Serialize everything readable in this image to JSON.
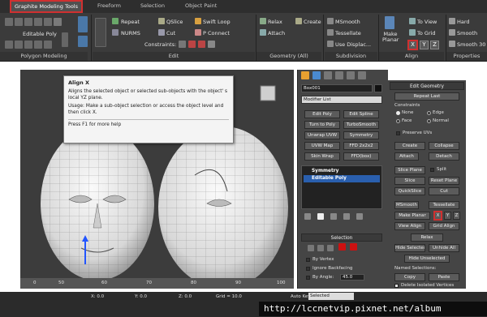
{
  "ribbon": {
    "tabs": [
      "Graphite Modeling Tools",
      "Freeform",
      "Selection",
      "Object Paint"
    ],
    "edit_poly_label": "Editable Poly",
    "polygon_modeling": "Polygon Modeling",
    "edit_items": {
      "repeat": "Repeat",
      "qslice": "QSlice",
      "swift_loop": "Swift Loop",
      "nurms": "NURMS",
      "cut": "Cut",
      "p_connect": "P Connect",
      "constraints": "Constraints:"
    },
    "geometry_items": {
      "relax": "Relax",
      "create": "Create",
      "attach": "Attach"
    },
    "subdivision_items": {
      "msmooth": "MSmooth",
      "tessellate": "Tessellate",
      "use_displac": "Use Displac..."
    },
    "align_items": {
      "make_planar": "Make Planar",
      "to_view": "To View",
      "to_grid": "To Grid",
      "x": "X",
      "y": "Y",
      "z": "Z"
    },
    "properties_items": {
      "hard": "Hard",
      "smooth": "Smooth",
      "smooth30": "Smooth 30"
    },
    "groups": {
      "edit": "Edit",
      "geometry": "Geometry (All)",
      "subdivision": "Subdivision",
      "align": "Align",
      "properties": "Properties"
    }
  },
  "tooltip": {
    "title": "Align X",
    "desc": "Aligns the selected object or selected sub-objects with the object' s local YZ plane.",
    "usage": "Usage: Make a sub-object selection or access the object level and then click X.",
    "help": "Press F1 for more help"
  },
  "command_panel": {
    "object_name": "Box001",
    "modifier_list": "Modifier List",
    "buttons": [
      "Edit Poly",
      "Edit Spline",
      "Turn to Poly",
      "TurboSmooth",
      "Unwrap UVW",
      "Symmetry",
      "UVW Map",
      "FFD 2x2x2",
      "Skin Wrap",
      "FFD(box)"
    ],
    "stack": [
      "Symmetry",
      "Editable Poly"
    ],
    "selection_header": "Selection",
    "selection_opts": [
      "By Vertex",
      "Ignore Backfacing",
      "By Angle:"
    ],
    "angle_value": "45.0"
  },
  "edit_geometry": {
    "header": "Edit Geometry",
    "repeat_last": "Repeat Last",
    "constraints": "Constraints",
    "radios": [
      "None",
      "Edge",
      "Face",
      "Normal"
    ],
    "preserve_uvs": "Preserve UVs",
    "create": "Create",
    "collapse": "Collapse",
    "attach": "Attach",
    "detach": "Detach",
    "slice_plane": "Slice Plane",
    "split": "Split",
    "slice": "Slice",
    "reset_plane": "Reset Plane",
    "quickslice": "QuickSlice",
    "cut": "Cut",
    "msmooth": "MSmooth",
    "tessellate": "Tessellate",
    "make_planar": "Make Planar",
    "x": "X",
    "y": "Y",
    "z": "Z",
    "view_align": "View Align",
    "grid_align": "Grid Align",
    "relax": "Relax",
    "hide_selected": "Hide Selected",
    "unhide_all": "Unhide All",
    "hide_unselected": "Hide Unselected",
    "named_selections": "Named Selections:",
    "copy": "Copy",
    "paste": "Paste",
    "delete_isolated": "Delete Isolated Vertices"
  },
  "timeline": {
    "ticks": [
      "0",
      "50",
      "60",
      "70",
      "80",
      "90",
      "100"
    ]
  },
  "status": {
    "x": "X: 0.0",
    "y": "Y: 0.0",
    "z": "Z: 0.0",
    "grid": "Grid = 10.0",
    "autokey": "Auto Key",
    "selected": "Selected"
  },
  "watermark": "http://lccnetvip.pixnet.net/album",
  "colors": {
    "accent_red": "#d03030",
    "stack_blue": "#2a5fae",
    "selection_red": "#cc1111"
  }
}
